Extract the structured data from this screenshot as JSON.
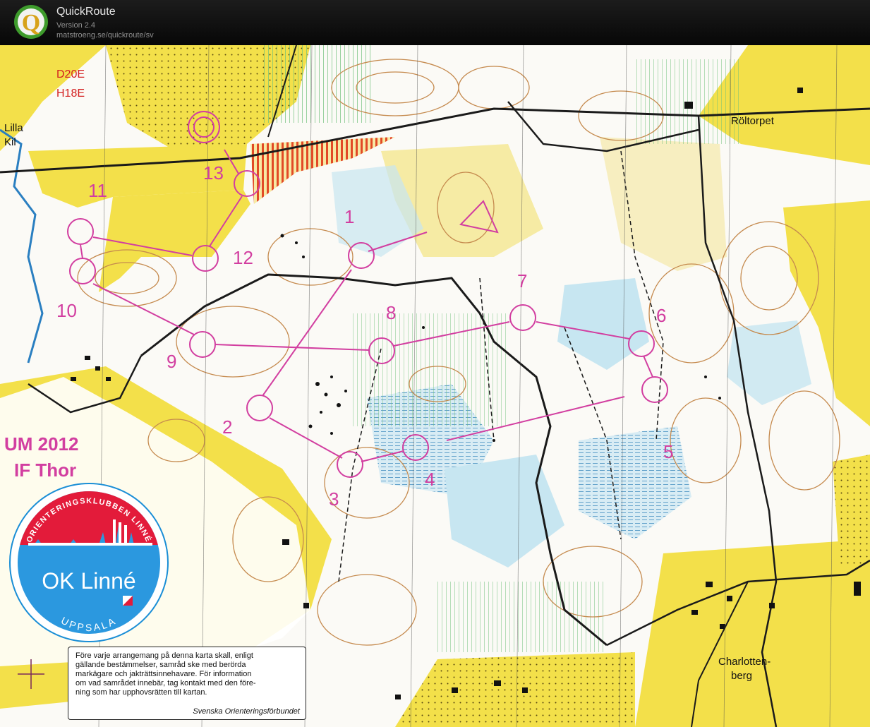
{
  "app": {
    "title": "QuickRoute",
    "version": "Version 2.4",
    "url": "matstroeng.se/quickroute/sv",
    "logo_letter": "Q"
  },
  "map": {
    "classes": [
      "D20E",
      "H18E"
    ],
    "event": [
      "UM 2012",
      "IF Thor"
    ],
    "places": {
      "lilla": "Lilla",
      "kil": "Kil",
      "roltorpet": "Röltorpet",
      "charlotten": "Charlotten-",
      "berg": "berg"
    },
    "controls": [
      "1",
      "2",
      "3",
      "4",
      "5",
      "6",
      "7",
      "8",
      "9",
      "10",
      "11",
      "12",
      "13"
    ],
    "club_badge": {
      "top_text": "ORIENTERINGSKLUBBEN LINNÉ",
      "name": "OK Linné",
      "bottom_text": "UPPSALA"
    },
    "notice": {
      "lines": [
        "Före varje arrangemang på denna karta skall, enligt",
        "gällande bestämmelser, samråd ske med berörda",
        "markägare och jakträttsinnehavare. För information",
        "om vad samrådet innebär, tag kontakt med den före-",
        "ning som har upphovsrätten till kartan."
      ],
      "signature": "Svenska Orienteringsförbundet"
    },
    "colors": {
      "course": "#d23ea0",
      "open_land": "#f3e04a",
      "marsh": "#c7e6f1",
      "contour": "#c58a4e",
      "road": "#1a1a1a",
      "forbidden": "#e24a26"
    }
  }
}
